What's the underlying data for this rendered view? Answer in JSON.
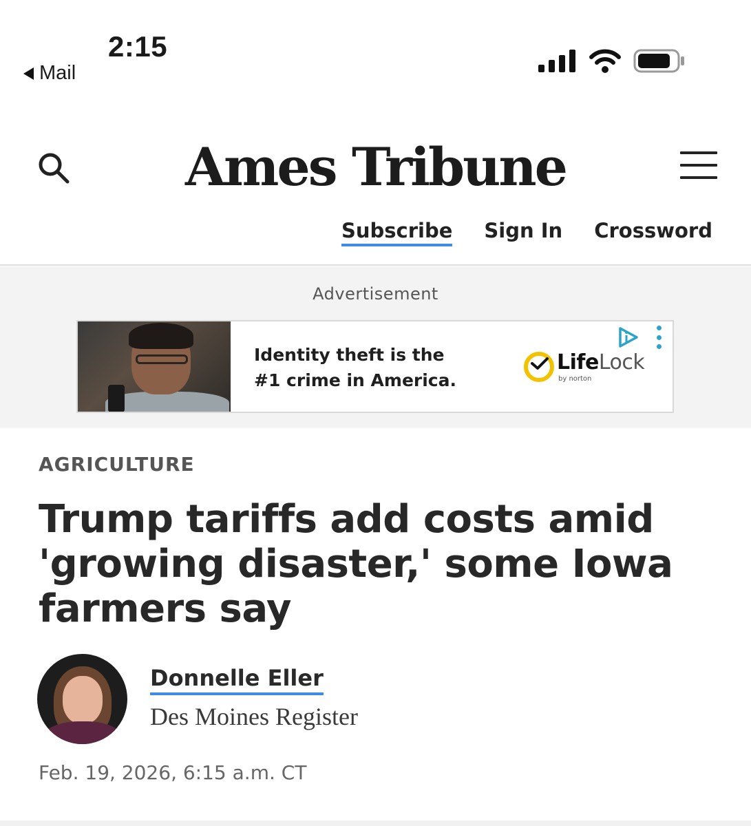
{
  "status_bar": {
    "time": "2:15",
    "back_label": "Mail"
  },
  "masthead": {
    "logo_text": "Ames Tribune",
    "links": {
      "subscribe": "Subscribe",
      "sign_in": "Sign In",
      "crossword": "Crossword"
    },
    "accent_color": "#3f8be6"
  },
  "ad": {
    "label": "Advertisement",
    "headline_line1": "Identity theft is the",
    "headline_line2": "#1 crime in America.",
    "brand_life": "Life",
    "brand_lock": "Lock",
    "brand_sub": "by norton",
    "brand_color": "#f2c200",
    "adchoices_color": "#2aa4c8"
  },
  "article": {
    "section": "AGRICULTURE",
    "headline": "Trump tariffs add costs amid 'growing disaster,' some Iowa farmers say",
    "author_name": "Donnelle Eller",
    "author_org": "Des Moines Register",
    "date": "Feb. 19, 2026, 6:15 a.m. CT"
  }
}
